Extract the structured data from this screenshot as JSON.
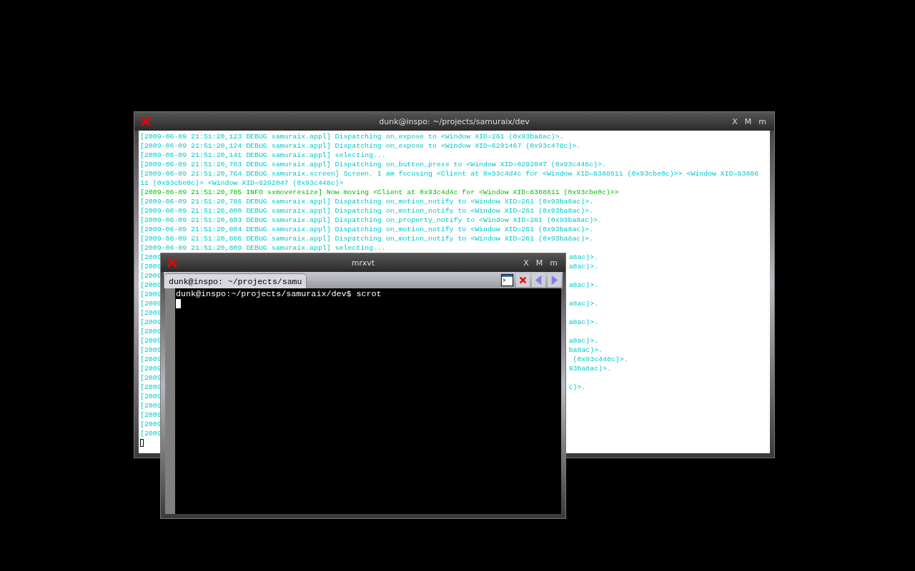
{
  "back_window": {
    "title": "dunk@inspo: ~/projects/samuraix/dev",
    "focused": false,
    "buttons": [
      "X",
      "M",
      "m"
    ],
    "lines": [
      {
        "kind": "debug",
        "text": "[2009-06-09 21:51:20,123 DEBUG samuraix.appl] Dispatching on_expose to <Window XID=261 (0x93ba8ac)>."
      },
      {
        "kind": "debug",
        "text": "[2009-06-09 21:51:20,124 DEBUG samuraix.appl] Dispatching on_expose to <Window XID=6291467 (0x93c478c)>."
      },
      {
        "kind": "debug",
        "text": "[2009-06-09 21:51:20,141 DEBUG samuraix.appl] selecting..."
      },
      {
        "kind": "debug",
        "text": "[2009-06-09 21:51:20,763 DEBUG samuraix.appl] Dispatching on_button_press to <Window XID=6292047 (0x93c448c)>."
      },
      {
        "kind": "debug",
        "text": "[2009-06-09 21:51:20,764 DEBUG samuraix.screen] Screen. I am focusing <Client at 0x93c4d4c for <Window XID=8388611 (0x93cbe0c)>> <Window XID=83886"
      },
      {
        "kind": "debug",
        "text": "11 (0x93cbe0c)> <Window XID=6292047 (0x93c448c)>"
      },
      {
        "kind": "info",
        "text": "[2009-06-09 21:51:20,785 INFO sxmoveresize] Now moving <Client at 0x93c4d4c for <Window XID=8388611 (0x93cbe0c)>>"
      },
      {
        "kind": "debug",
        "text": "[2009-06-09 21:51:20,786 DEBUG samuraix.appl] Dispatching on_motion_notify to <Window XID=261 (0x93ba8ac)>."
      },
      {
        "kind": "debug",
        "text": "[2009-06-09 21:51:20,800 DEBUG samuraix.appl] Dispatching on_motion_notify to <Window XID=261 (0x93ba8ac)>."
      },
      {
        "kind": "debug",
        "text": "[2009-06-09 21:51:20,803 DEBUG samuraix.appl] Dispatching on_property_notify to <Window XID=261 (0x93ba8ac)>."
      },
      {
        "kind": "debug",
        "text": "[2009-06-09 21:51:20,804 DEBUG samuraix.appl] Dispatching on_motion_notify to <Window XID=261 (0x93ba8ac)>."
      },
      {
        "kind": "debug",
        "text": "[2009-06-09 21:51:20,806 DEBUG samuraix.appl] Dispatching on_motion_notify to <Window XID=261 (0x93ba8ac)>."
      },
      {
        "kind": "debug",
        "text": "[2009-06-09 21:51:20,809 DEBUG samuraix.appl] selecting..."
      }
    ],
    "covered_lines": [
      {
        "kind": "debug",
        "left": "[2009",
        "right": "a8ac)>."
      },
      {
        "kind": "debug",
        "left": "[2009",
        "right": "a8ac)>."
      },
      {
        "kind": "debug",
        "left": "[2009"
      },
      {
        "kind": "debug",
        "left": "[2009",
        "right": "a8ac)>."
      },
      {
        "kind": "debug",
        "left": "[2009"
      },
      {
        "kind": "debug",
        "left": "[2009",
        "right": "a8ac)>."
      },
      {
        "kind": "debug",
        "left": "[2009"
      },
      {
        "kind": "debug",
        "left": "[2009",
        "right": "a8ac)>."
      },
      {
        "kind": "debug",
        "left": "[2009"
      },
      {
        "kind": "debug",
        "left": "[2009",
        "right": "a8ac)>."
      },
      {
        "kind": "debug",
        "left": "[2009",
        "right": "ba8ac)>."
      },
      {
        "kind": "debug",
        "left": "[2009",
        "right": " (0x93c448c)>."
      },
      {
        "kind": "debug",
        "left": "[2009",
        "right": "93ba8ac)>."
      },
      {
        "kind": "debug",
        "left": "[2009"
      },
      {
        "kind": "debug",
        "left": "[2009",
        "right": "c)>."
      },
      {
        "kind": "debug",
        "left": "[2009"
      },
      {
        "kind": "debug",
        "left": "[2009"
      },
      {
        "kind": "debug",
        "left": "[2009"
      },
      {
        "kind": "debug",
        "left": "[2009"
      },
      {
        "kind": "debug",
        "left": "[2009"
      }
    ]
  },
  "front_window": {
    "title": "mrxvt",
    "focused": true,
    "buttons": [
      "X",
      "M",
      "m"
    ],
    "tabs": [
      {
        "label": "dunk@inspo: ~/projects/samu",
        "selected": true
      }
    ],
    "prompt": "dunk@inspo:~/projects/samuraix/dev$ scrot"
  }
}
